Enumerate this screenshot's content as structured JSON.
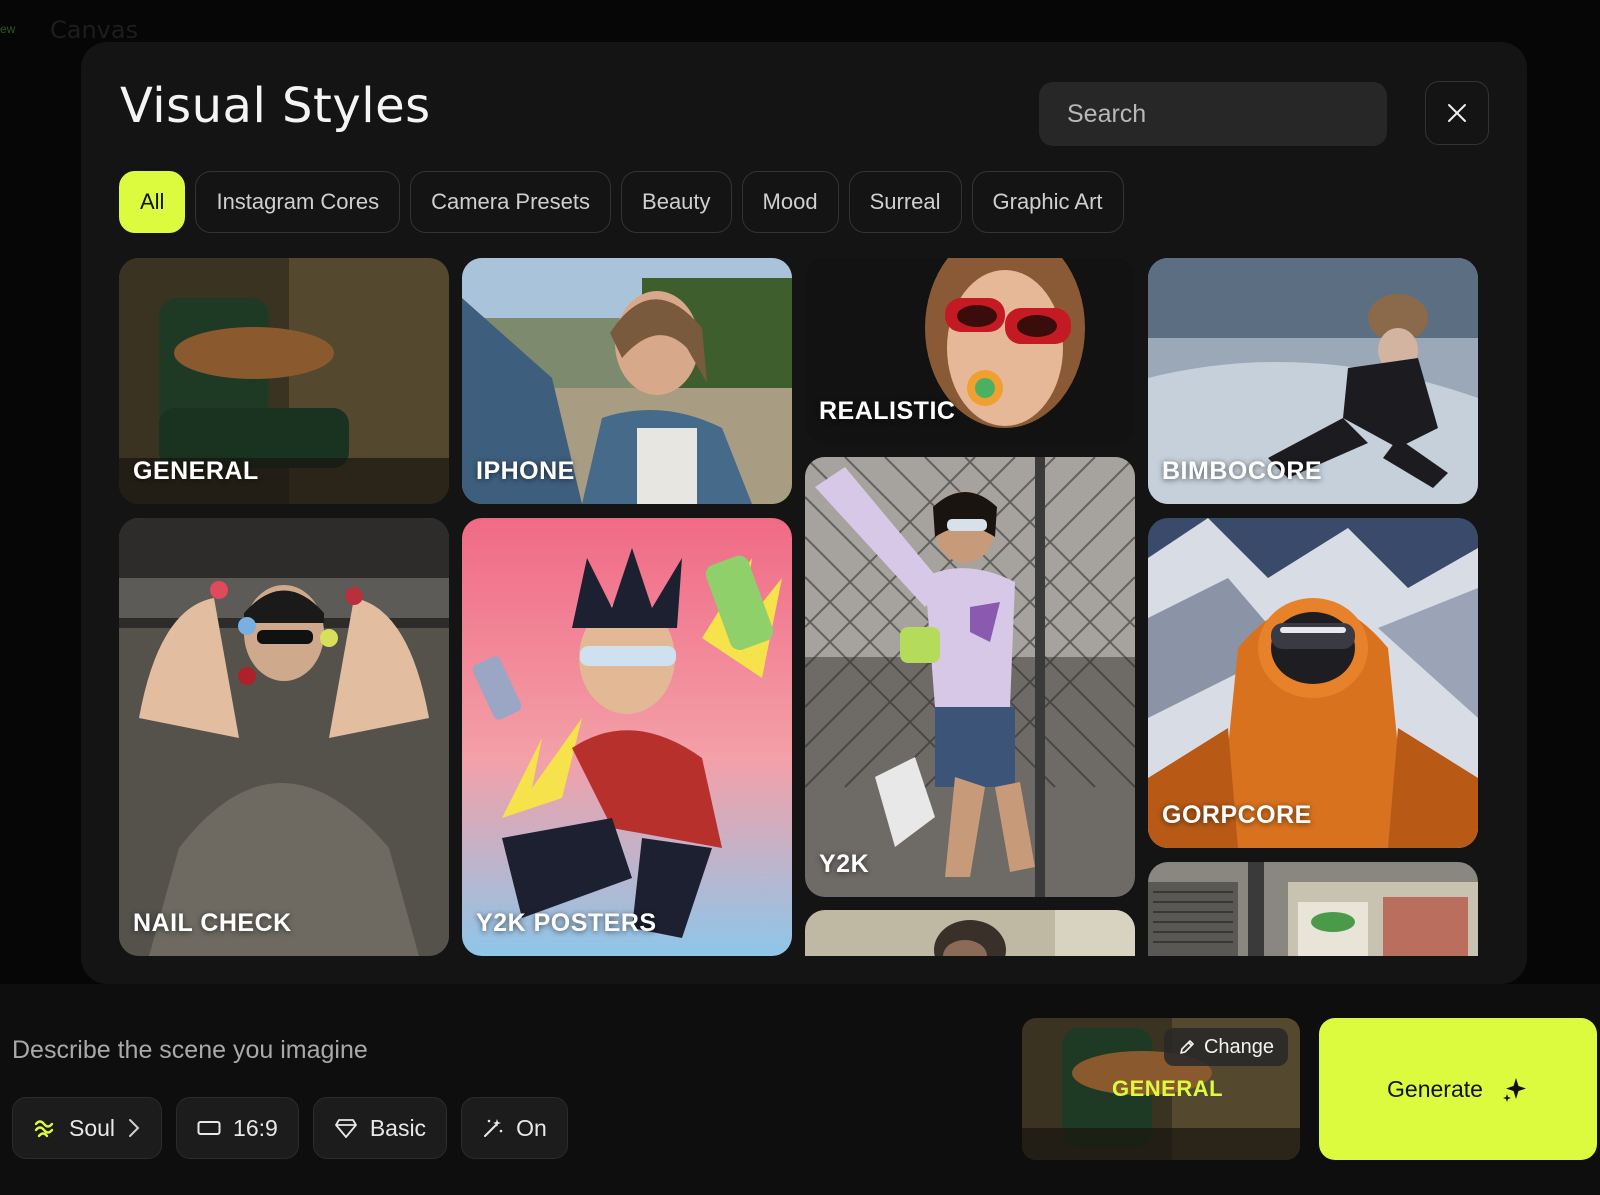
{
  "background": {
    "title": "Canvas",
    "new_label": "ew"
  },
  "modal": {
    "title": "Visual Styles",
    "search": {
      "placeholder": "Search"
    },
    "filters": [
      "All",
      "Instagram Cores",
      "Camera Presets",
      "Beauty",
      "Mood",
      "Surreal",
      "Graphic Art"
    ],
    "active_filter": "All",
    "cards": {
      "general": "GENERAL",
      "iphone": "IPHONE",
      "realistic": "REALISTIC",
      "bimbocore": "BIMBOCORE",
      "nail_check": "NAIL CHECK",
      "y2k_posters": "Y2K POSTERS",
      "y2k": "Y2K",
      "gorpcore": "GORPCORE"
    }
  },
  "composer": {
    "prompt_placeholder": "Describe the scene you imagine",
    "model": "Soul",
    "aspect_ratio": "16:9",
    "quality": "Basic",
    "enhance": "On",
    "selected_style": "GENERAL",
    "change_label": "Change",
    "generate_label": "Generate"
  },
  "colors": {
    "accent": "#dcfb3e",
    "panel": "#141414",
    "bar": "#0e0e0e"
  }
}
